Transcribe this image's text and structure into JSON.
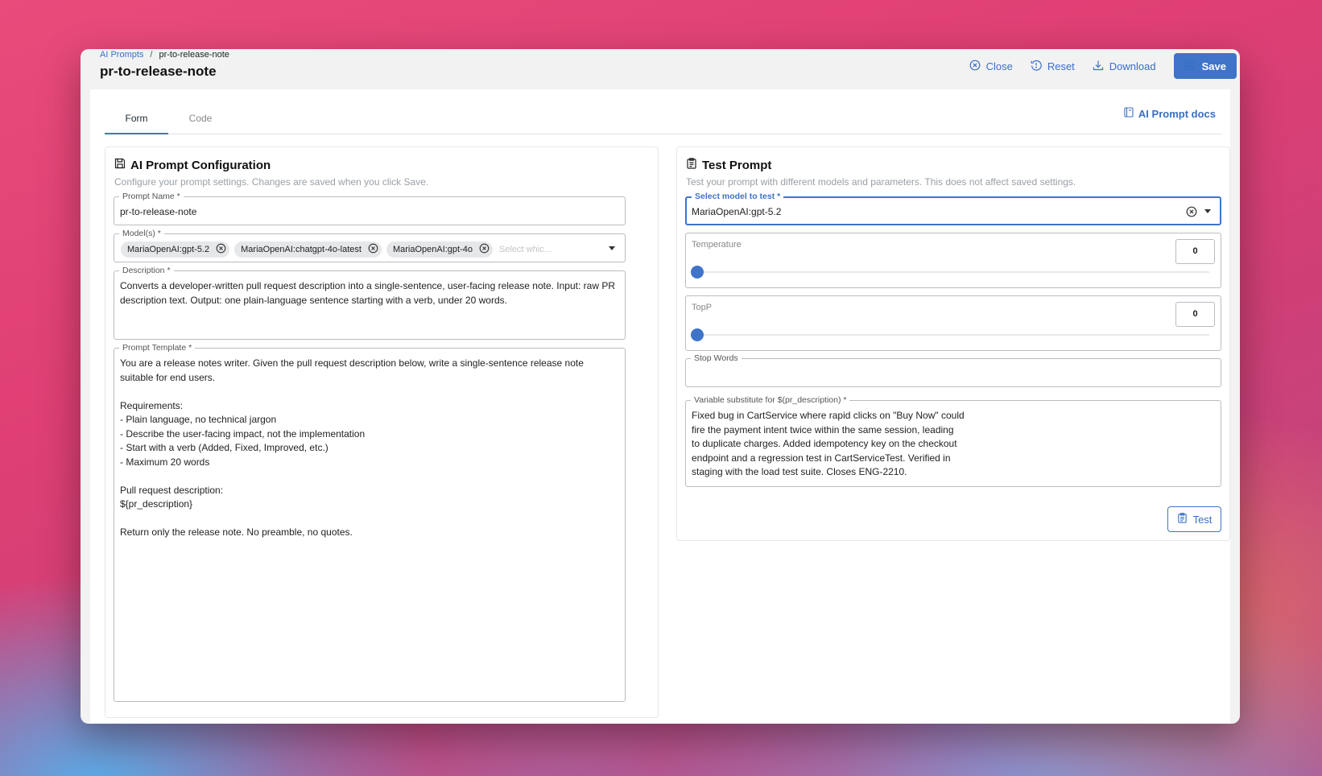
{
  "breadcrumb": {
    "root": "AI Prompts",
    "separator": "/",
    "current": "pr-to-release-note"
  },
  "page_title": "pr-to-release-note",
  "actions": {
    "close": "Close",
    "reset": "Reset",
    "download": "Download",
    "save": "Save"
  },
  "tabs": {
    "form": "Form",
    "code": "Code"
  },
  "docs_link": "AI Prompt docs",
  "config": {
    "title": "AI Prompt Configuration",
    "subtitle": "Configure your prompt settings. Changes are saved when you click Save.",
    "prompt_name": {
      "label": "Prompt Name *",
      "value": "pr-to-release-note"
    },
    "models": {
      "label": "Model(s) *",
      "selected": [
        "MariaOpenAI:gpt-5.2",
        "MariaOpenAI:chatgpt-4o-latest",
        "MariaOpenAI:gpt-4o"
      ],
      "placeholder": "Select whic..."
    },
    "description": {
      "label": "Description *",
      "value": "Converts a developer-written pull request description into a single-sentence, user-facing release note. Input: raw PR description text. Output: one plain-language sentence starting with a verb, under 20 words."
    },
    "template": {
      "label": "Prompt Template *",
      "value": "You are a release notes writer. Given the pull request description below, write a single-sentence release note\nsuitable for end users.\n\nRequirements:\n- Plain language, no technical jargon\n- Describe the user-facing impact, not the implementation\n- Start with a verb (Added, Fixed, Improved, etc.)\n- Maximum 20 words\n\nPull request description:\n${pr_description}\n\nReturn only the release note. No preamble, no quotes."
    }
  },
  "test": {
    "title": "Test Prompt",
    "subtitle": "Test your prompt with different models and parameters. This does not affect saved settings.",
    "model": {
      "label": "Select model to test *",
      "value": "MariaOpenAI:gpt-5.2"
    },
    "temperature": {
      "label": "Temperature",
      "value": "0",
      "level": 0
    },
    "topp": {
      "label": "TopP",
      "value": "0",
      "level": 0
    },
    "stop_words": {
      "label": "Stop Words",
      "value": ""
    },
    "variable": {
      "label": "Variable substitute for $(pr_description) *",
      "value": "Fixed bug in CartService where rapid clicks on \"Buy Now\" could\nfire the payment intent twice within the same session, leading\nto duplicate charges. Added idempotency key on the checkout\nendpoint and a regression test in CartServiceTest. Verified in\nstaging with the load test suite. Closes ENG-2210."
    },
    "button": "Test"
  },
  "colors": {
    "accent": "#3f74c9",
    "link": "#3a6fc4"
  }
}
